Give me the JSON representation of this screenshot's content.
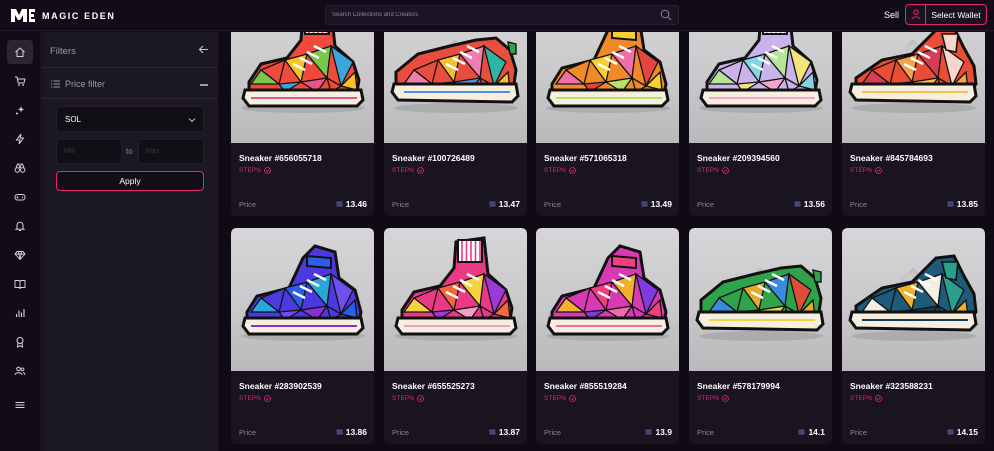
{
  "app": {
    "brand": "MAGIC EDEN"
  },
  "search": {
    "placeholder": "Search Collections and Creators"
  },
  "header": {
    "sell_label": "Sell",
    "wallet_label": "Select Wallet"
  },
  "sidebar": {
    "items": [
      {
        "icon": "home-icon",
        "active": true
      },
      {
        "icon": "cart-icon"
      },
      {
        "icon": "sparkles-icon"
      },
      {
        "icon": "lightning-icon"
      },
      {
        "icon": "binoculars-icon"
      },
      {
        "icon": "gamepad-icon"
      },
      {
        "icon": "bell-icon"
      },
      {
        "icon": "diamond-icon"
      },
      {
        "icon": "book-icon"
      },
      {
        "icon": "bar-chart-icon"
      },
      {
        "icon": "award-icon"
      },
      {
        "icon": "users-icon"
      },
      {
        "icon": "menu-icon"
      }
    ]
  },
  "filters": {
    "title": "Filters",
    "price_filter_label": "Price filter",
    "currency": "SOL",
    "min_placeholder": "Min",
    "max_placeholder": "Max",
    "to_label": "to",
    "apply_label": "Apply"
  },
  "listing": {
    "price_label": "Price",
    "items": [
      {
        "name": "Sneaker #656055718",
        "collection": "STEPN",
        "price": "13.46",
        "style": "hightop",
        "colors": [
          "#ef4a3c",
          "#f7c32a",
          "#3aa7dc",
          "#7ac84b",
          "#e8548a"
        ]
      },
      {
        "name": "Sneaker #100726489",
        "collection": "STEPN",
        "price": "13.47",
        "style": "low",
        "colors": [
          "#e84d3d",
          "#f2c12e",
          "#2fb5a4",
          "#ef7eb0",
          "#4f8fe0"
        ]
      },
      {
        "name": "Sneaker #571065318",
        "collection": "STEPN",
        "price": "13.49",
        "style": "mid",
        "colors": [
          "#f08a28",
          "#f4d032",
          "#e2463e",
          "#ee6fa6",
          "#b7e06a"
        ]
      },
      {
        "name": "Sneaker #209394560",
        "collection": "STEPN",
        "price": "13.56",
        "style": "hightop",
        "colors": [
          "#c9b3ea",
          "#86d2e8",
          "#f4e37a",
          "#b6e59a",
          "#f2a6c9"
        ]
      },
      {
        "name": "Sneaker #845784693",
        "collection": "STEPN",
        "price": "13.85",
        "style": "runner",
        "colors": [
          "#e94d35",
          "#f2a24a",
          "#f7d6cc",
          "#d63c55",
          "#f1c04d"
        ]
      },
      {
        "name": "Sneaker #283902539",
        "collection": "STEPN",
        "price": "13.86",
        "style": "mid",
        "colors": [
          "#4a3ae0",
          "#2b5ee6",
          "#6f4ff0",
          "#2aa7d8",
          "#8a2fd2"
        ]
      },
      {
        "name": "Sneaker #655525273",
        "collection": "STEPN",
        "price": "13.87",
        "style": "hightop",
        "colors": [
          "#ea3a86",
          "#f26a3a",
          "#9b3ad8",
          "#f4d43a",
          "#f0a0c8"
        ]
      },
      {
        "name": "Sneaker #855519284",
        "collection": "STEPN",
        "price": "13.9",
        "style": "mid",
        "colors": [
          "#d93ab4",
          "#ef3f7e",
          "#7f3ae0",
          "#f2b02e",
          "#ee6aa8"
        ]
      },
      {
        "name": "Sneaker #578179994",
        "collection": "STEPN",
        "price": "14.1",
        "style": "low",
        "colors": [
          "#2fa34a",
          "#e8a82c",
          "#e24a3a",
          "#3a8be0",
          "#f0d43a"
        ]
      },
      {
        "name": "Sneaker #323588231",
        "collection": "STEPN",
        "price": "14.15",
        "style": "runner",
        "colors": [
          "#1e5a7a",
          "#f2b02a",
          "#2aa08a",
          "#f2f0e4",
          "#163a55"
        ]
      }
    ]
  },
  "colors": {
    "accent": "#e42575",
    "background": "#120c18",
    "panel": "#1c1823",
    "card": "#1a1421"
  }
}
